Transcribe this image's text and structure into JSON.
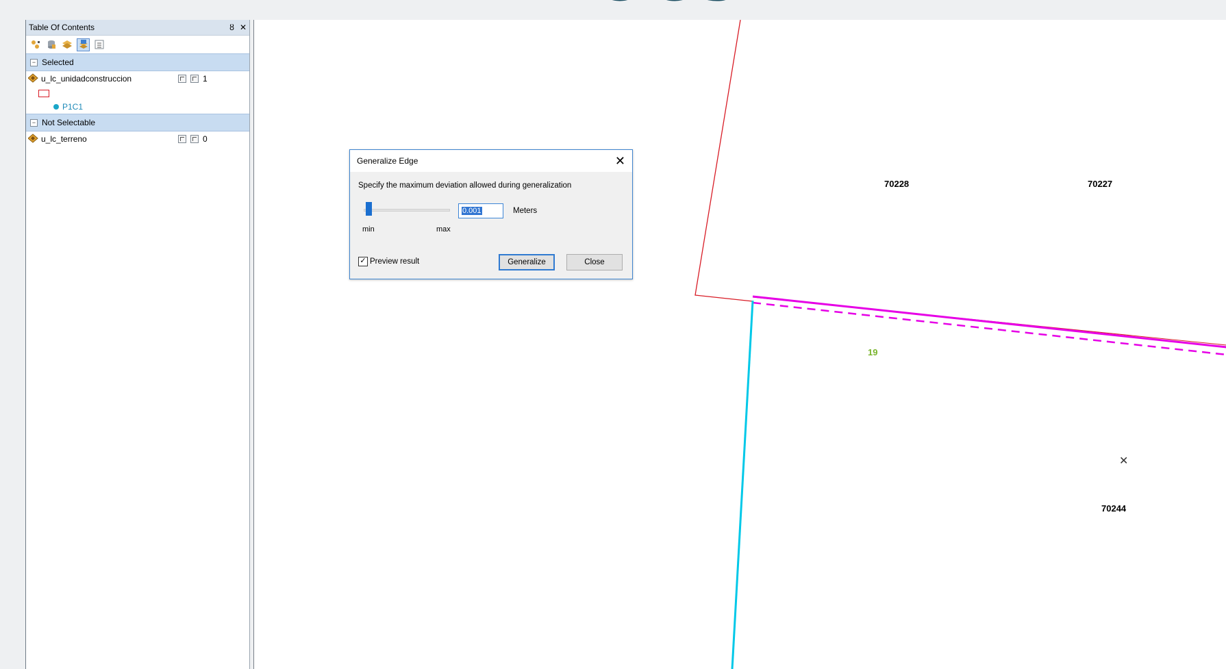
{
  "background_title": "DOCS",
  "toc": {
    "title": "Table Of Contents",
    "pin_glyph": "ȣ",
    "close_glyph": "✕",
    "toolbar_icons": [
      "list-by-drawing-order-icon",
      "list-by-source-icon",
      "list-by-visibility-icon",
      "list-by-selection-icon",
      "options-icon"
    ],
    "groups": [
      {
        "label": "Selected",
        "layers": [
          {
            "name": "u_lc_unidadconstruccion",
            "count": "1",
            "symbol_color": "#d81b25",
            "sublabel": "P1C1"
          }
        ]
      },
      {
        "label": "Not Selectable",
        "layers": [
          {
            "name": "u_lc_terreno",
            "count": "0"
          }
        ]
      }
    ]
  },
  "map": {
    "labels": [
      "70228",
      "70227",
      "19",
      "70244"
    ],
    "colors": {
      "parcel_outline": "#d81b25",
      "selected_edge": "#e600e6",
      "terrain_edge": "#00c8e8",
      "label_green": "#7ab42d"
    }
  },
  "dialog": {
    "title": "Generalize Edge",
    "close_glyph": "✕",
    "description": "Specify the maximum deviation allowed during generalization",
    "slider": {
      "min_label": "min",
      "max_label": "max",
      "position": 0.03
    },
    "value": "0.001",
    "units": "Meters",
    "preview_label": "Preview result",
    "preview_checked": "✓",
    "generalize_label": "Generalize",
    "close_label": "Close"
  }
}
